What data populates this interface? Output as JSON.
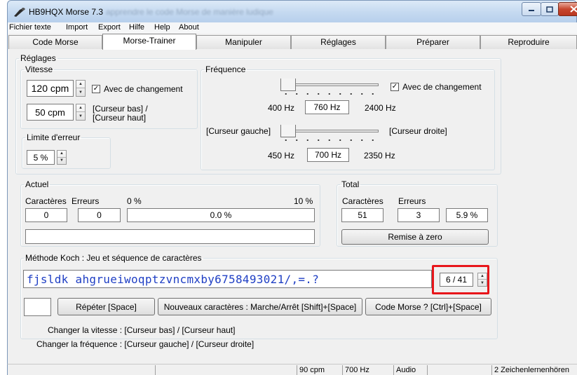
{
  "window": {
    "title": "HB9HQX Morse 7.3",
    "ghost_title": "apprendre le code Morse de manière ludique"
  },
  "menu": [
    "Fichier texte",
    "Import",
    "Export",
    "Hilfe",
    "Help",
    "About"
  ],
  "tabs": [
    "Code Morse",
    "Morse-Trainer",
    "Manipuler",
    "Réglages",
    "Préparer",
    "Reproduire"
  ],
  "active_tab": "Morse-Trainer",
  "reglages": {
    "title": "Réglages",
    "vitesse": {
      "title": "Vitesse",
      "speed_value": "120 cpm",
      "change_label": "Avec de changement",
      "change_checked": true,
      "second_value": "50 cpm",
      "cursor_hint_1": "[Curseur bas] /",
      "cursor_hint_2": "[Curseur haut]"
    },
    "limite": {
      "title": "Limite d'erreur",
      "value": "5 %"
    },
    "frequence": {
      "title": "Fréquence",
      "change_label": "Avec de changement",
      "change_checked": true,
      "slider1_min": "400 Hz",
      "slider1_value": "760 Hz",
      "slider1_max": "2400 Hz",
      "cursor_left": "[Curseur gauche]",
      "cursor_right": "[Curseur droite]",
      "slider2_min": "450 Hz",
      "slider2_value": "700 Hz",
      "slider2_max": "2350 Hz"
    }
  },
  "actuel": {
    "title": "Actuel",
    "caracteres_label": "Caractères",
    "erreurs_label": "Erreurs",
    "pct_min": "0 %",
    "pct_max": "10 %",
    "caracteres": "0",
    "erreurs": "0",
    "progress_text": "0.0 %"
  },
  "total": {
    "title": "Total",
    "caracteres_label": "Caractères",
    "erreurs_label": "Erreurs",
    "caracteres": "51",
    "erreurs": "3",
    "pct": "5.9 %",
    "reset_label": "Remise à zero"
  },
  "koch": {
    "title": "Méthode Koch : Jeu et séquence de caractères",
    "sequence": "fjsldk  ahgrueiwoqptzvncmxby6758493021/,=.?",
    "counter": "6 / 41",
    "repeat_label": "Répéter  [Space]",
    "new_chars_label": "Nouveaux caractères : Marche/Arrêt  [Shift]+[Space]",
    "morse_label": "Code Morse ?  [Ctrl]+[Space]",
    "hint_speed": "Changer la vitesse :  [Curseur bas] / [Curseur haut]",
    "hint_freq": "Changer la fréquence :  [Curseur gauche] / [Curseur droite]"
  },
  "status": {
    "cpm": "90 cpm",
    "hz": "700 Hz",
    "audio": "Audio",
    "mode": "2 Zeichenlernenhören"
  },
  "colors": {
    "highlight": "#e8161b",
    "sequence_text": "#1f3fc4"
  }
}
